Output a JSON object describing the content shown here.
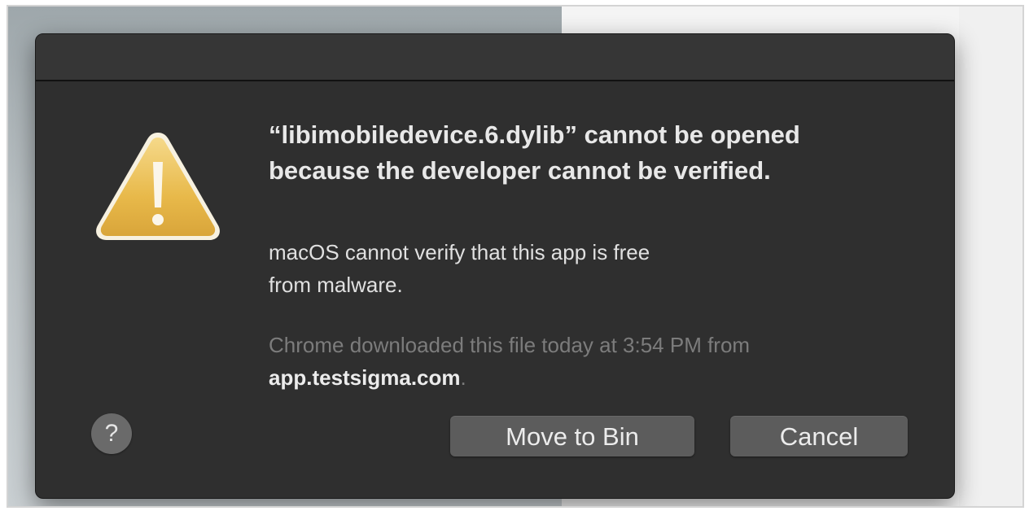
{
  "dialog": {
    "title": "“libimobiledevice.6.dylib” cannot be opened because the developer cannot be verified.",
    "message_line1": "macOS cannot verify that this app is free",
    "message_line2": "from malware.",
    "source_prefix": "Chrome downloaded this file today at 3:54 PM from",
    "source_domain": "app.testsigma.com",
    "source_suffix": ".",
    "help_label": "?",
    "move_to_bin_label": "Move to Bin",
    "cancel_label": "Cancel",
    "icon": "warning-triangle-icon"
  },
  "colors": {
    "dialog_background": "#2f2f2f",
    "button_background": "#5c5c5c",
    "warning_yellow": "#e8b94a"
  }
}
